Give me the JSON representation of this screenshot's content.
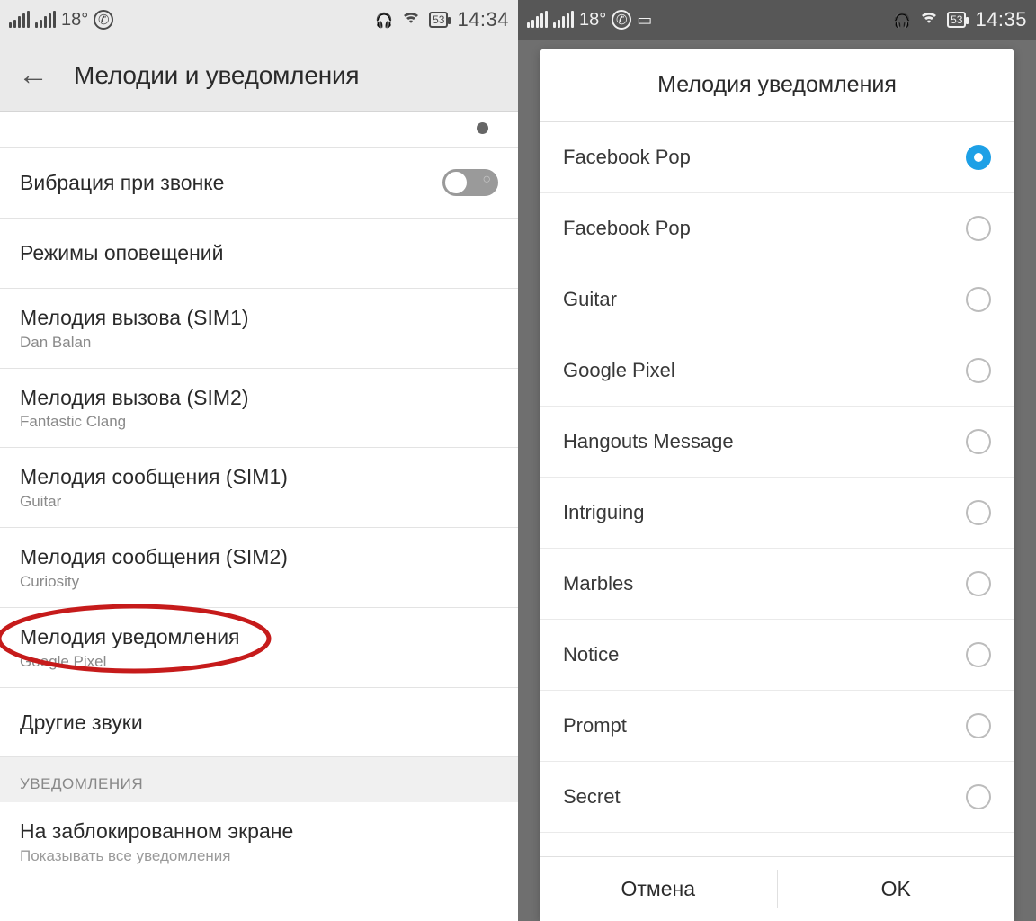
{
  "left": {
    "status": {
      "temp": "18°",
      "battery": "53",
      "time": "14:34"
    },
    "header_title": "Мелодии и уведомления",
    "rows": {
      "vibrate": "Вибрация при звонке",
      "alert_modes": "Режимы оповещений",
      "ring_sim1": {
        "title": "Мелодия вызова (SIM1)",
        "sub": "Dan Balan"
      },
      "ring_sim2": {
        "title": "Мелодия вызова (SIM2)",
        "sub": "Fantastic Clang"
      },
      "msg_sim1": {
        "title": "Мелодия сообщения (SIM1)",
        "sub": "Guitar"
      },
      "msg_sim2": {
        "title": "Мелодия сообщения (SIM2)",
        "sub": "Curiosity"
      },
      "notif_tone": {
        "title": "Мелодия уведомления",
        "sub": "Google Pixel"
      },
      "other_sounds": "Другие звуки",
      "section": "УВЕДОМЛЕНИЯ",
      "lock": {
        "title": "На заблокированном экране",
        "sub": "Показывать все уведомления"
      }
    }
  },
  "right": {
    "status": {
      "temp": "18°",
      "battery": "53",
      "time": "14:35"
    },
    "dialog_title": "Мелодия уведомления",
    "options": [
      "Facebook Pop",
      "Facebook Pop",
      "Guitar",
      "Google Pixel",
      "Hangouts Message",
      "Intriguing",
      "Marbles",
      "Notice",
      "Prompt",
      "Secret"
    ],
    "selected_index": 0,
    "cancel": "Отмена",
    "ok": "OK"
  }
}
